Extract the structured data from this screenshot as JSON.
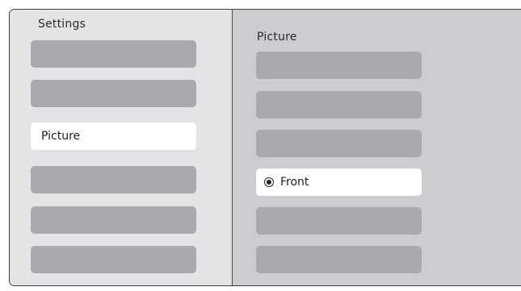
{
  "settings_panel": {
    "title": "Settings",
    "items": [
      {
        "label": "",
        "state": "placeholder"
      },
      {
        "label": "",
        "state": "placeholder"
      },
      {
        "label": "Picture",
        "state": "selected"
      },
      {
        "label": "",
        "state": "placeholder"
      },
      {
        "label": "",
        "state": "placeholder"
      },
      {
        "label": "",
        "state": "placeholder"
      }
    ]
  },
  "picture_panel": {
    "title": "Picture",
    "options": [
      {
        "label": "",
        "state": "placeholder"
      },
      {
        "label": "",
        "state": "placeholder"
      },
      {
        "label": "",
        "state": "placeholder"
      },
      {
        "label": "Front",
        "state": "selected",
        "radio": "checked"
      },
      {
        "label": "",
        "state": "placeholder"
      },
      {
        "label": "",
        "state": "placeholder"
      }
    ]
  },
  "colors": {
    "left_panel_bg": "#e4e3e5",
    "right_panel_bg": "#cfccd1",
    "placeholder_item": "#aaa9ae",
    "selected_item": "#ffffff"
  },
  "icons": {
    "radio": "radio-checked-icon"
  }
}
